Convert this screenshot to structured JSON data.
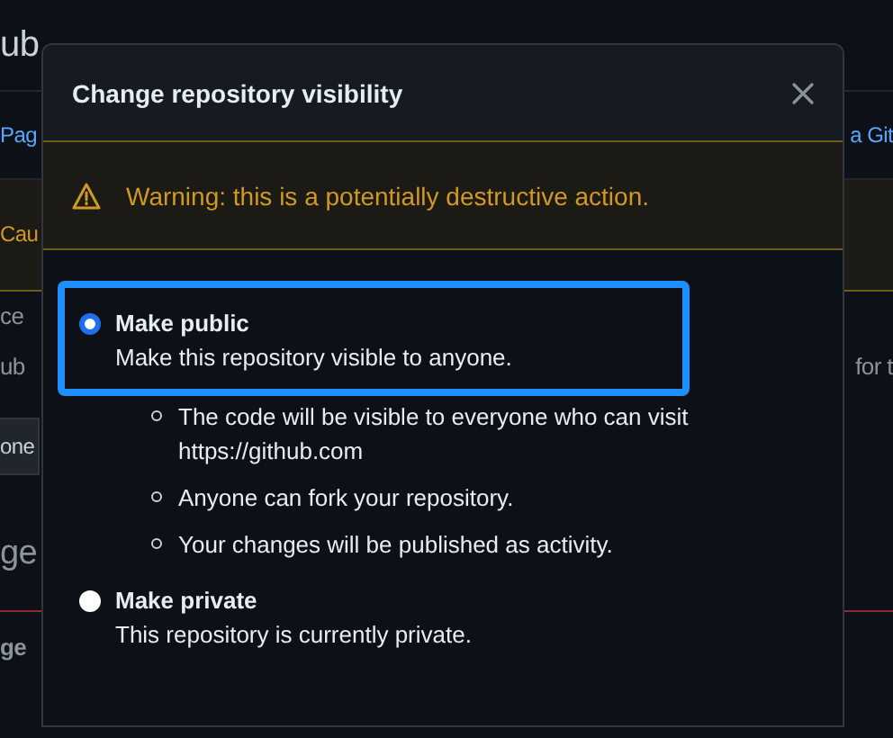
{
  "background_page": {
    "sections": [
      {
        "kind": "heading",
        "left": "ub"
      },
      {
        "kind": "link",
        "left": "Pag",
        "right": "a Git"
      },
      {
        "kind": "caution",
        "left": "Cau"
      },
      {
        "kind": "text",
        "left": "ce"
      },
      {
        "kind": "text",
        "left": "ub",
        "right": "for t"
      },
      {
        "kind": "button",
        "left": "one"
      },
      {
        "kind": "heading2",
        "left": "ge"
      },
      {
        "kind": "bold",
        "left": "ge"
      }
    ]
  },
  "dialog": {
    "title": "Change repository visibility",
    "warning": "Warning: this is a potentially destructive action.",
    "options": [
      {
        "label": "Make public",
        "description": "Make this repository visible to anyone.",
        "selected": true,
        "details": [
          "The code will be visible to everyone who can visit https://github.com",
          "Anyone can fork your repository.",
          "Your changes will be published as activity."
        ]
      },
      {
        "label": "Make private",
        "description": "This repository is currently private.",
        "selected": false
      }
    ]
  }
}
